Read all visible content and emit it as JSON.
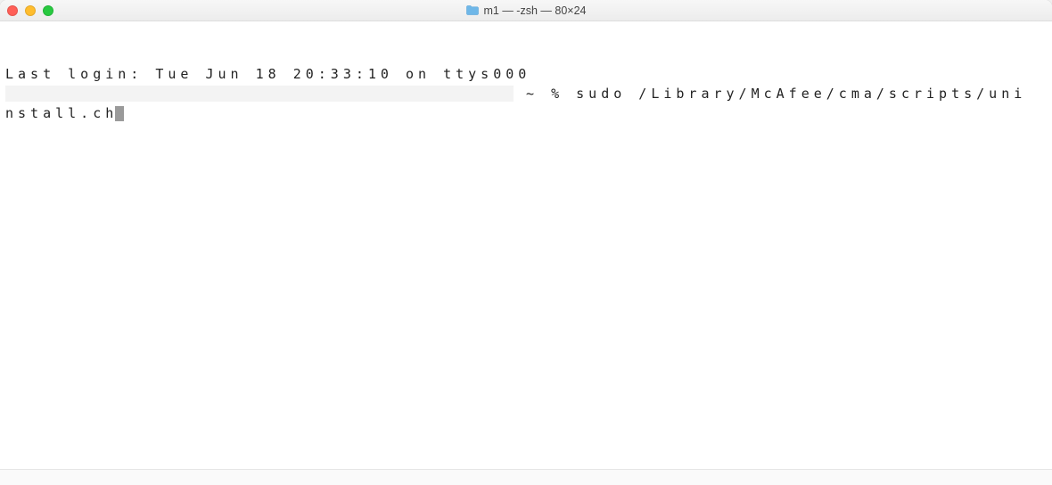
{
  "window": {
    "title": "m1 — -zsh — 80×24"
  },
  "terminal": {
    "last_login": "Last login: Tue Jun 18 20:33:10 on ttys000",
    "prompt_suffix": " ~ % ",
    "command_part1": "sudo /Library/McAfee/cma/scripts/uni",
    "command_part2": "nstall.ch"
  }
}
